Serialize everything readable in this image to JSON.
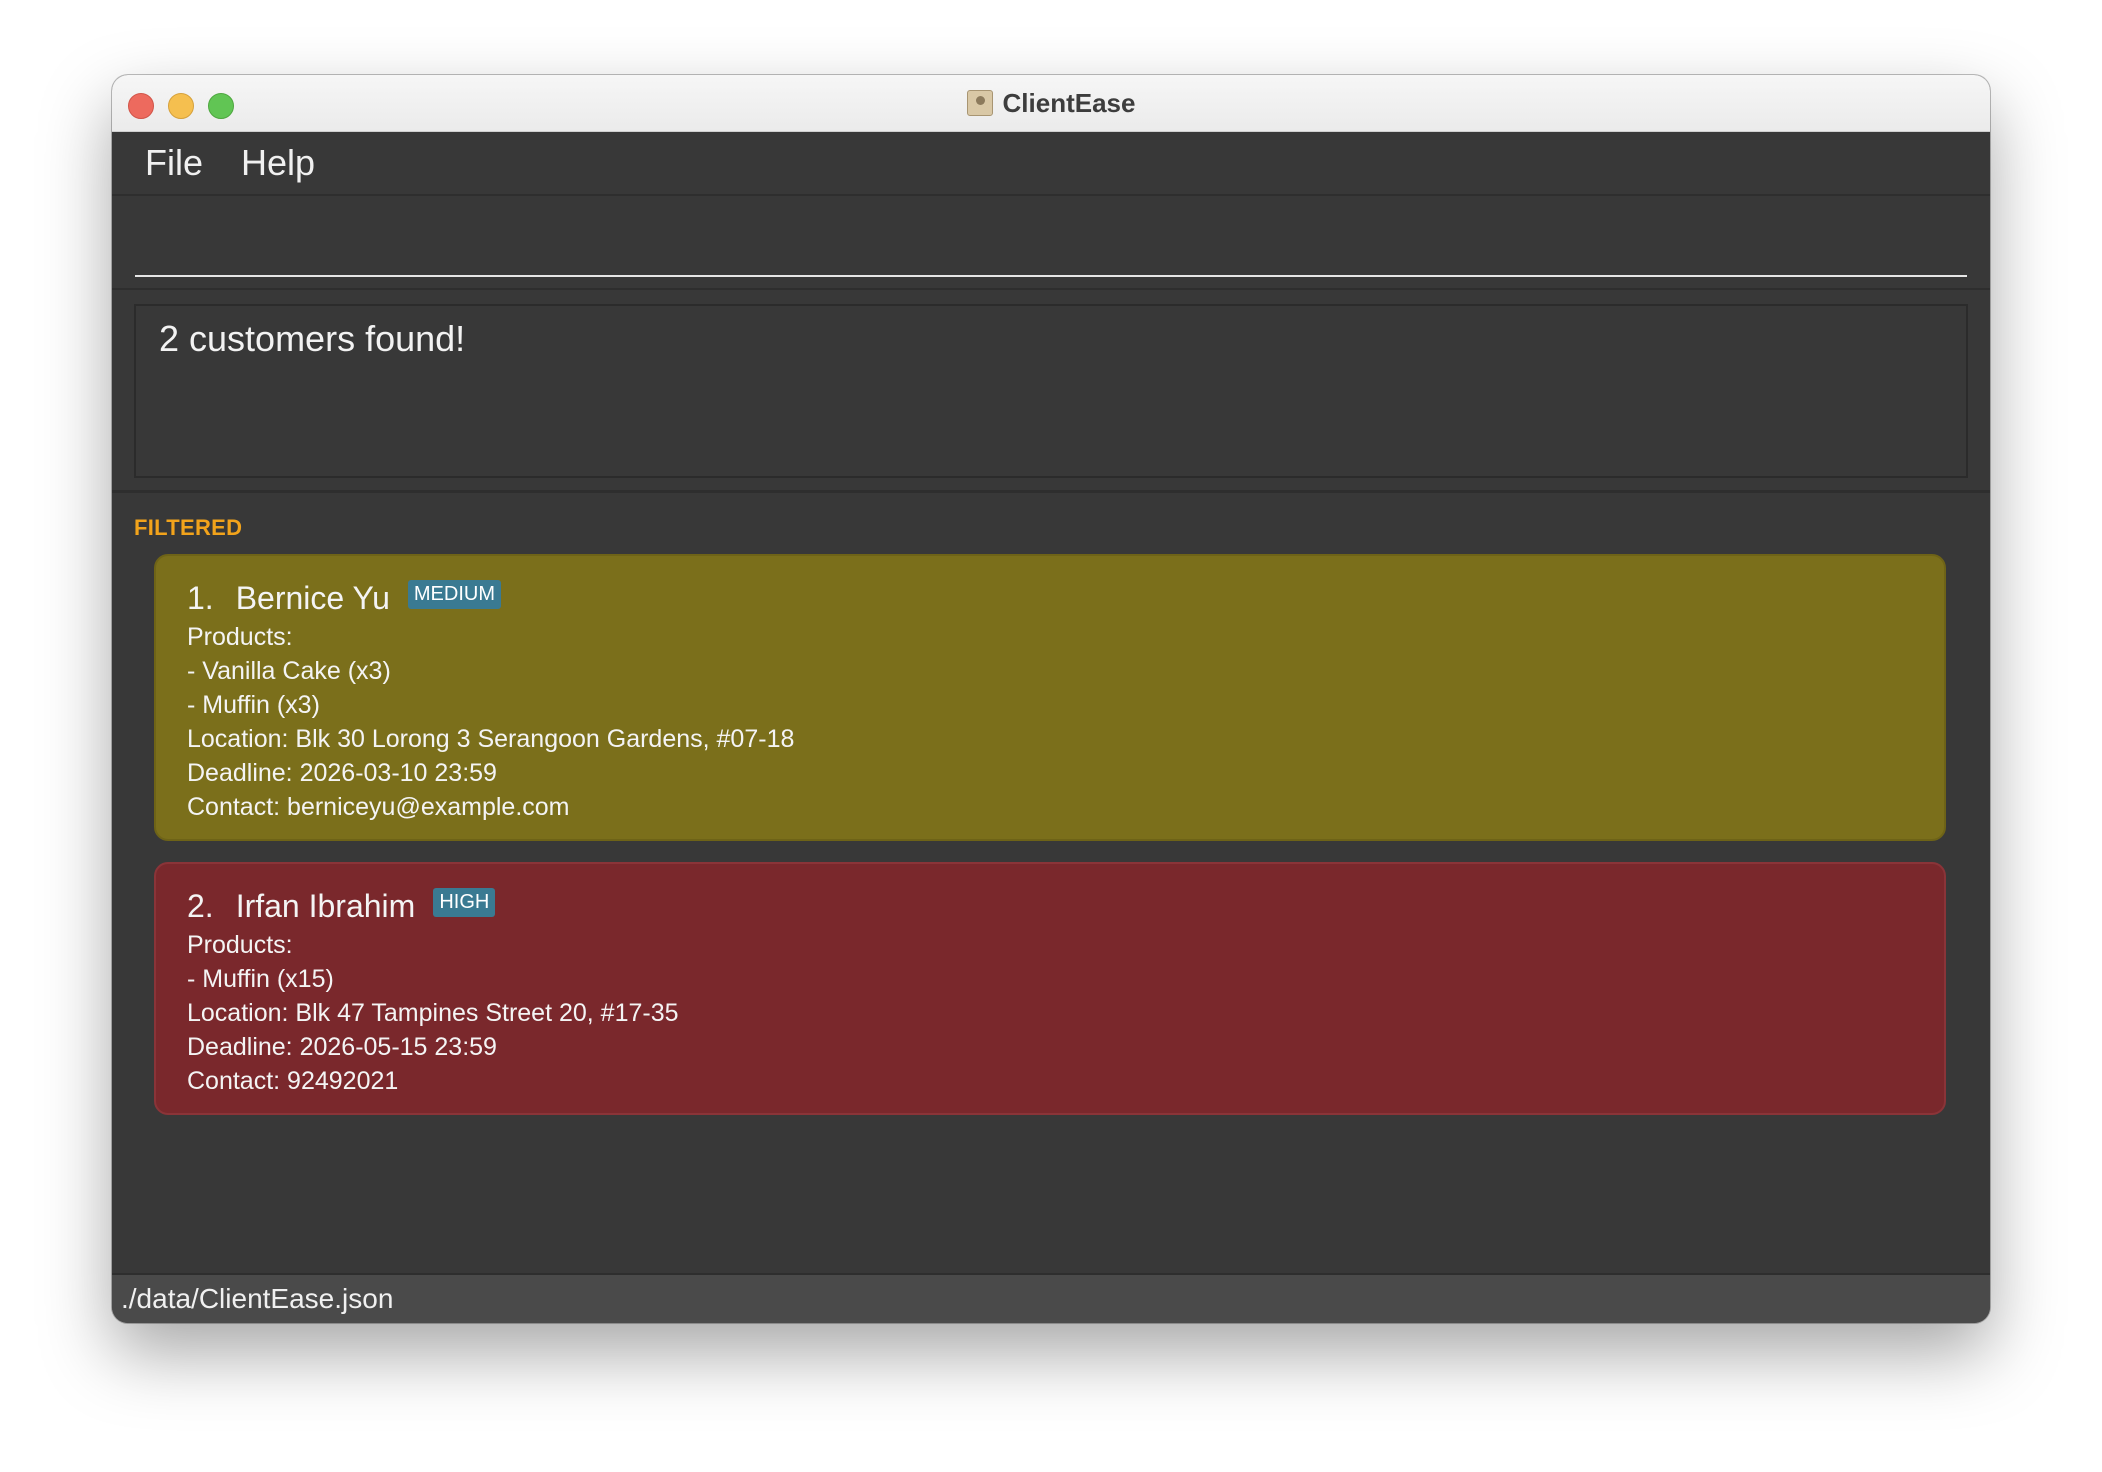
{
  "window": {
    "title": "ClientEase",
    "app_icon": "address-book-icon"
  },
  "menu": {
    "items": [
      "File",
      "Help"
    ]
  },
  "command": {
    "value": "",
    "placeholder": ""
  },
  "result": {
    "message": "2 customers found!"
  },
  "list": {
    "filter_label": "FILTERED",
    "customers": [
      {
        "index": "1.",
        "name": "Bernice Yu",
        "priority": "MEDIUM",
        "products_label": "Products:",
        "products": [
          "- Vanilla Cake (x3)",
          "- Muffin (x3)"
        ],
        "location": "Location: Blk 30 Lorong 3 Serangoon Gardens, #07-18",
        "deadline": "Deadline: 2026-03-10 23:59",
        "contact": "Contact: berniceyu@example.com",
        "color": "#7b6f1b"
      },
      {
        "index": "2.",
        "name": "Irfan Ibrahim",
        "priority": "HIGH",
        "products_label": "Products:",
        "products": [
          "- Muffin (x15)"
        ],
        "location": "Location: Blk 47 Tampines Street 20, #17-35",
        "deadline": "Deadline: 2026-05-15 23:59",
        "contact": "Contact: 92492021",
        "color": "#7a282c"
      }
    ]
  },
  "status": {
    "path": "./data/ClientEase.json"
  },
  "colors": {
    "background": "#383838",
    "accent": "#f2a31b",
    "badge": "#3a7a92"
  }
}
